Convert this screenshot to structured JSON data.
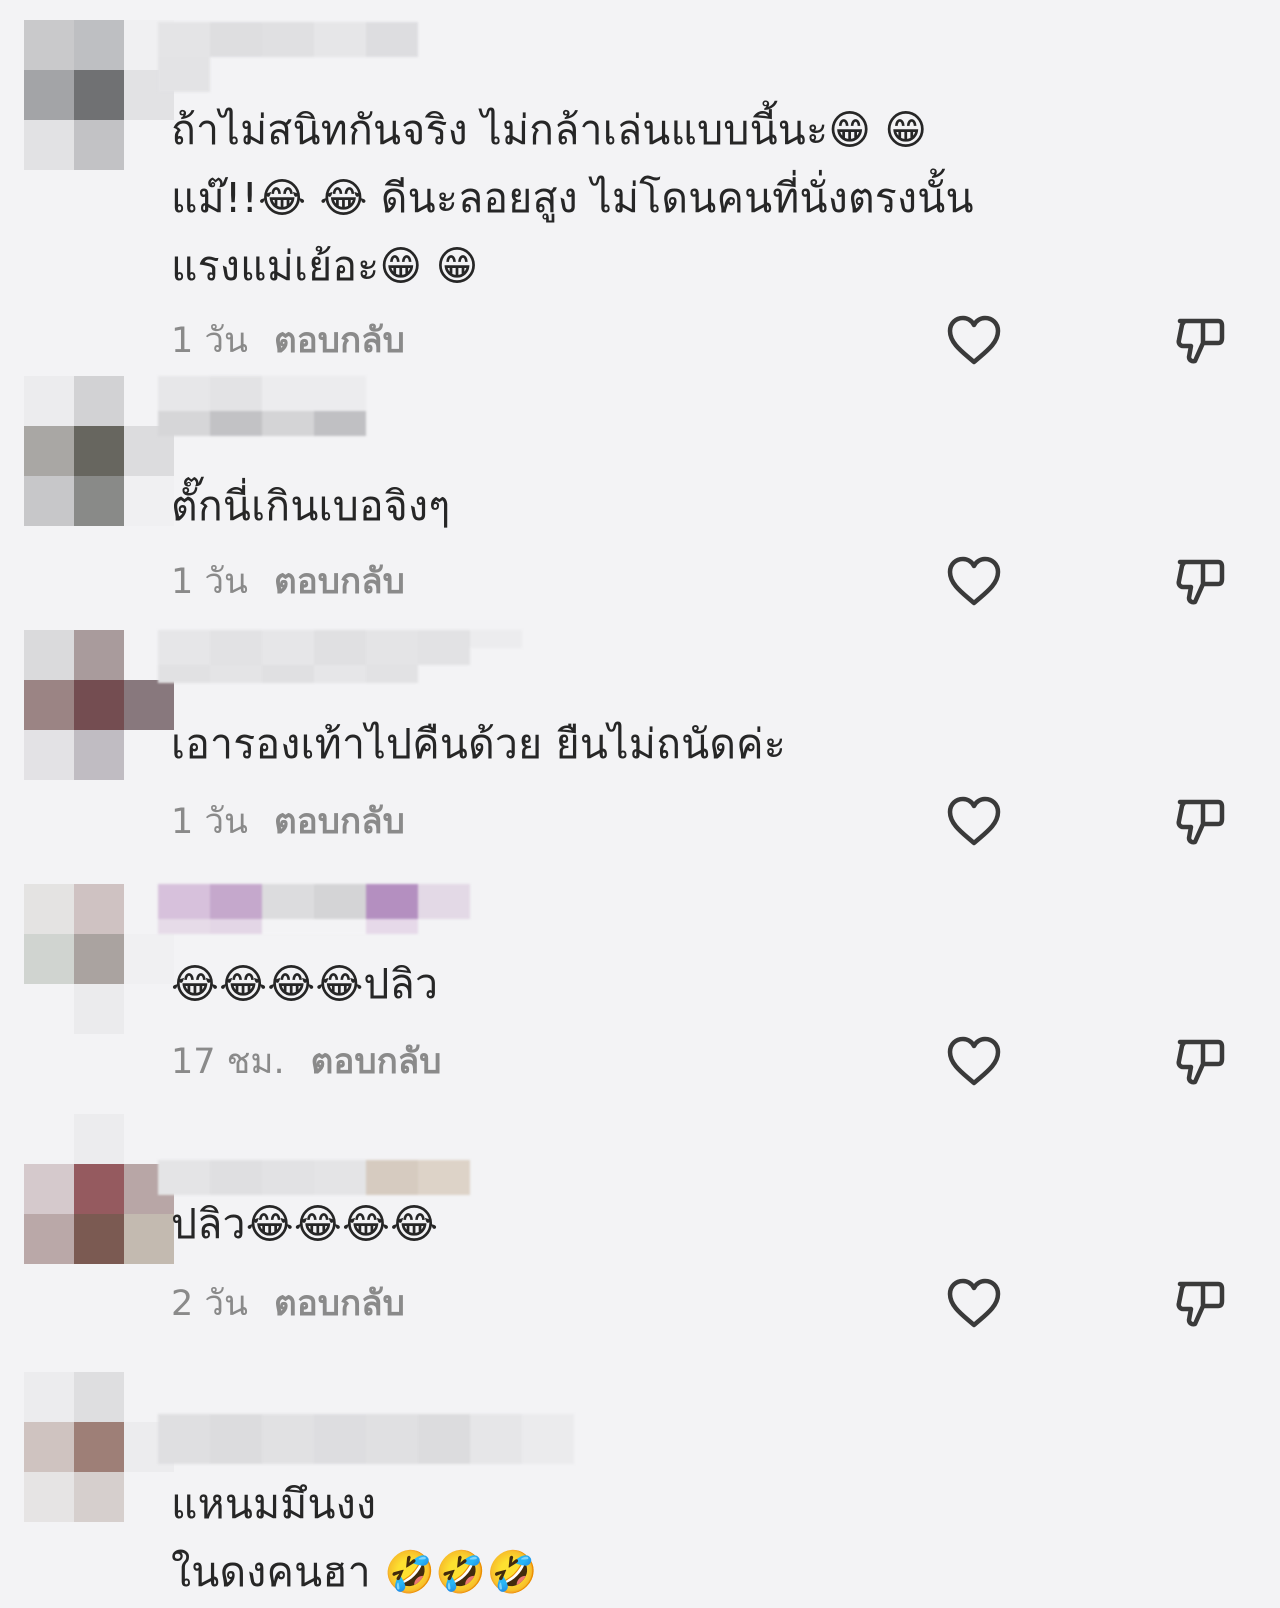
{
  "comments": [
    {
      "text": "ถ้าไม่สนิทกันจริง ไม่กล้าเล่นแบบนี้นะ😁 😁\nแม๊!!😂 😂 ดีนะลอยสูง ไม่โดนคนที่นั่งตรงนั้น\nแรงแม่เย้อะ😁 😁",
      "time": "1 วัน",
      "reply": "ตอบกลับ"
    },
    {
      "text": "ตั๊กนี่เกินเบอจิงๆ",
      "time": "1 วัน",
      "reply": "ตอบกลับ"
    },
    {
      "text": "เอารองเท้าไปคืนด้วย ยืนไม่ถนัดค่ะ",
      "time": "1 วัน",
      "reply": "ตอบกลับ"
    },
    {
      "text": "😂😂😂😂ปลิว",
      "time": "17 ชม.",
      "reply": "ตอบกลับ"
    },
    {
      "text": "ปลิว😂😂😂😂",
      "time": "2 วัน",
      "reply": "ตอบกลับ"
    },
    {
      "text": "แหนมมึนงง\nในดงคนฮา 🤣🤣🤣",
      "time": "",
      "reply": ""
    }
  ],
  "colors": {
    "background": "#f3f3f5",
    "text": "#262626",
    "meta": "#8a8a8a",
    "icon": "#3a3a3a"
  },
  "icons": {
    "like": "heart-outline-icon",
    "dislike": "thumbs-down-outline-icon"
  }
}
